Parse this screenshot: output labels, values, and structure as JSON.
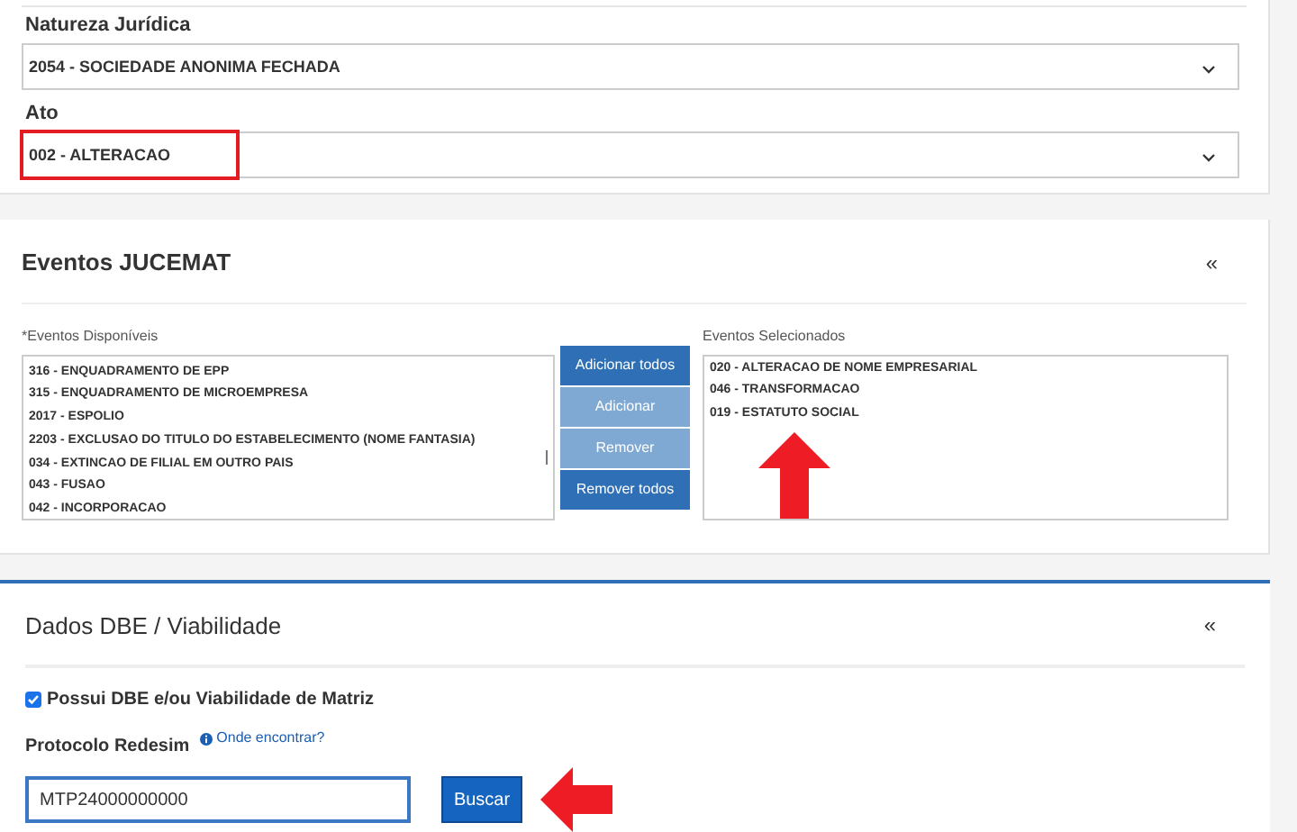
{
  "identificacao": {
    "fields": [
      {
        "label": "Natureza Jurídica",
        "value": "2054 - SOCIEDADE ANONIMA FECHADA",
        "highlighted": false
      },
      {
        "label": "Ato",
        "value": "002 - ALTERACAO",
        "highlighted": true
      }
    ]
  },
  "eventos": {
    "title": "Eventos JUCEMAT",
    "collapse": "«",
    "available_label": "*Eventos Disponíveis",
    "selected_label": "Eventos Selecionados",
    "available": [
      "316 - ENQUADRAMENTO DE EPP",
      "315 - ENQUADRAMENTO DE MICROEMPRESA",
      "2017 - ESPOLIO",
      "2203 - EXCLUSAO DO TITULO DO ESTABELECIMENTO (NOME FANTASIA)",
      "034 - EXTINCAO DE FILIAL EM OUTRO PAIS",
      "043 - FUSAO",
      "042 - INCORPORACAO"
    ],
    "buttons": [
      {
        "label": "Adicionar todos",
        "disabled": false
      },
      {
        "label": "Adicionar",
        "disabled": true
      },
      {
        "label": "Remover",
        "disabled": true
      },
      {
        "label": "Remover todos",
        "disabled": false
      }
    ],
    "selected": [
      "020 - ALTERACAO DE NOME EMPRESARIAL",
      "046 - TRANSFORMACAO",
      "019 - ESTATUTO SOCIAL"
    ]
  },
  "dbe": {
    "title": "Dados DBE / Viabilidade",
    "collapse": "«",
    "checkbox": {
      "label": "Possui DBE e/ou Viabilidade de Matriz",
      "checked": true
    },
    "protocolo_label": "Protocolo Redesim",
    "help_link": "Onde encontrar?",
    "protocolo_value": "MTP24000000000",
    "search_button": "Buscar"
  }
}
